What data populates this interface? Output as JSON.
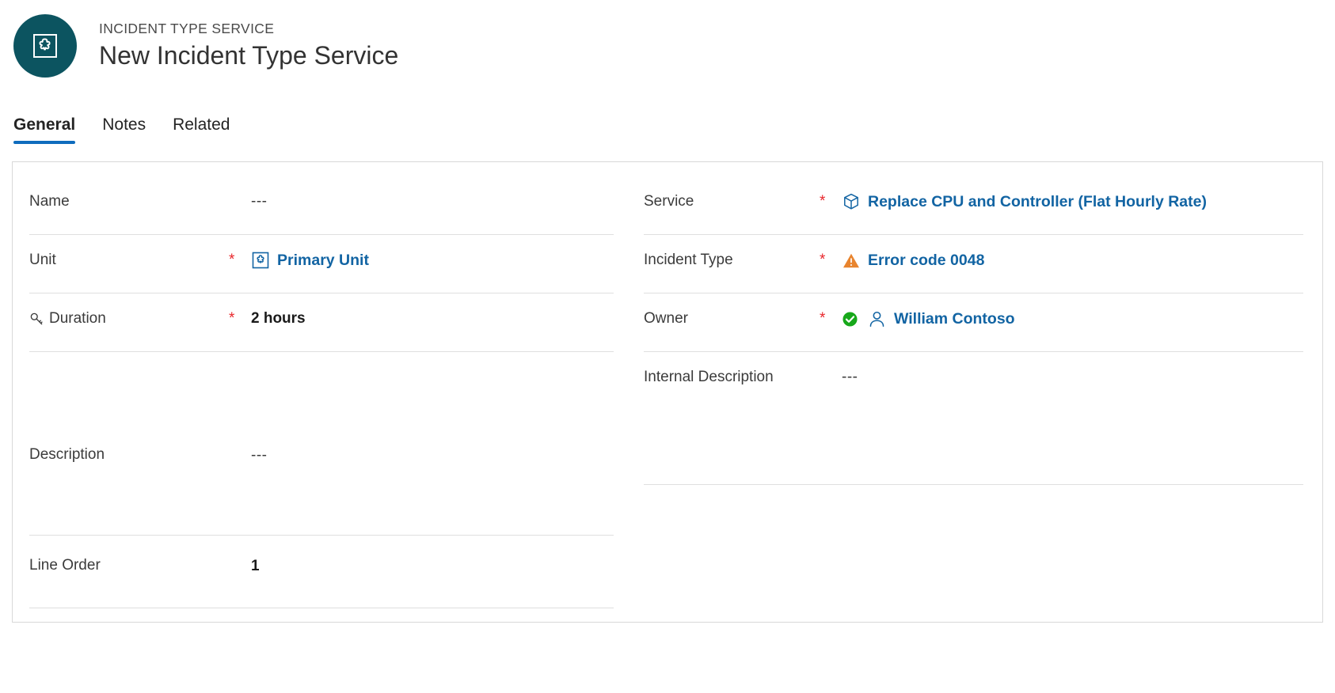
{
  "header": {
    "kicker": "INCIDENT TYPE SERVICE",
    "title": "New Incident Type Service",
    "avatar_icon": "incident-type-service-icon",
    "avatar_color": "#0c5460"
  },
  "tabs": {
    "active": "General",
    "items": [
      {
        "label": "General",
        "active": true
      },
      {
        "label": "Notes",
        "active": false
      },
      {
        "label": "Related",
        "active": false
      }
    ],
    "accent_color": "#0f6cbd"
  },
  "colors": {
    "required_star": "#e8262b",
    "link": "#1264a3",
    "warning": "#e87b2a",
    "success": "#12a83c",
    "rule": "#dfdfdf"
  },
  "form": {
    "left_column": {
      "name": {
        "label": "Name",
        "required": false,
        "required_marker": "*",
        "value": "---"
      },
      "unit": {
        "label": "Unit",
        "required": true,
        "required_marker": "*",
        "value": "Primary Unit",
        "icon": "unit-puzzle-icon"
      },
      "duration": {
        "label": "Duration",
        "label_icon": "key-icon",
        "required": true,
        "required_marker": "*",
        "value": "2 hours"
      },
      "description": {
        "label": "Description",
        "required": false,
        "required_marker": "*",
        "value": "---"
      },
      "line_order": {
        "label": "Line Order",
        "required": false,
        "required_marker": "*",
        "value": "1"
      }
    },
    "right_column": {
      "service": {
        "label": "Service",
        "required": true,
        "required_marker": "*",
        "value": "Replace CPU and Controller (Flat Hourly Rate)",
        "icon": "service-box-icon"
      },
      "incident_type": {
        "label": "Incident Type",
        "required": true,
        "required_marker": "*",
        "value": "Error code 0048",
        "icon": "warning-triangle-icon"
      },
      "owner": {
        "label": "Owner",
        "required": true,
        "required_marker": "*",
        "value": "William Contoso",
        "status_icon": "green-check-icon",
        "icon": "person-icon"
      },
      "internal_description": {
        "label": "Internal Description",
        "required": false,
        "required_marker": "*",
        "value": "---"
      }
    }
  }
}
